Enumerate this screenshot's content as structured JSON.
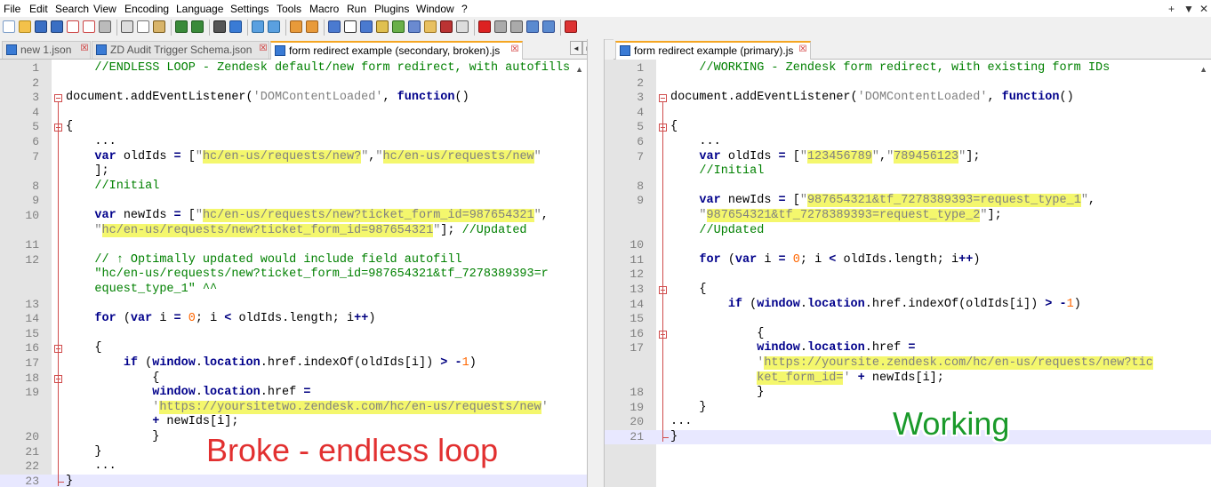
{
  "menubar": {
    "items": [
      "File",
      "Edit",
      "Search",
      "View",
      "Encoding",
      "Language",
      "Settings",
      "Tools",
      "Macro",
      "Run",
      "Plugins",
      "Window",
      "?"
    ],
    "right_controls": [
      "+",
      "▼",
      "✕"
    ]
  },
  "left_tabs": [
    {
      "label": "new 1.json"
    },
    {
      "label": "ZD Audit Trigger Schema.json"
    },
    {
      "label": "form redirect example (secondary, broken).js"
    }
  ],
  "right_tabs": [
    {
      "label": "form redirect example (primary).js"
    }
  ],
  "tab_nav": [
    "◄",
    "►"
  ],
  "annotations": {
    "left": "Broke - endless loop",
    "right": "Working",
    "left_color": "#e23030",
    "right_color": "#1a9a2a"
  },
  "colors": {
    "keyword": "#00008b",
    "comment": "#008000",
    "string": "#808080",
    "number": "#ff6600",
    "highlight": "#f4f76d",
    "current_line": "#e8e8ff",
    "active_tab_accent": "#f5a623"
  },
  "left_editor": {
    "current_line": 23,
    "lines": [
      {
        "n": "1",
        "t": "    //ENDLESS LOOP - Zendesk default/new form redirect, with autofills"
      },
      {
        "n": "2",
        "t": ""
      },
      {
        "n": "3",
        "t": "document.addEventListener('DOMContentLoaded', function()"
      },
      {
        "n": "4",
        "t": ""
      },
      {
        "n": "5",
        "t": "{"
      },
      {
        "n": "6",
        "t": "    ..."
      },
      {
        "n": "7",
        "t": "    var oldIds = [\"hc/en-us/requests/new?\",\"hc/en-us/requests/new\""
      },
      {
        "n": "",
        "t": "    ];"
      },
      {
        "n": "8",
        "t": "    //Initial"
      },
      {
        "n": "9",
        "t": ""
      },
      {
        "n": "10",
        "t": "    var newIds = [\"hc/en-us/requests/new?ticket_form_id=987654321\","
      },
      {
        "n": "",
        "t": "    \"hc/en-us/requests/new?ticket_form_id=987654321\"]; //Updated"
      },
      {
        "n": "11",
        "t": ""
      },
      {
        "n": "12",
        "t": "    // ↑ Optimally updated would include field autofill"
      },
      {
        "n": "",
        "t": "    \"hc/en-us/requests/new?ticket_form_id=987654321&tf_7278389393=r"
      },
      {
        "n": "",
        "t": "    equest_type_1\" ^^"
      },
      {
        "n": "13",
        "t": ""
      },
      {
        "n": "14",
        "t": "    for (var i = 0; i < oldIds.length; i++)"
      },
      {
        "n": "15",
        "t": ""
      },
      {
        "n": "16",
        "t": "    {"
      },
      {
        "n": "17",
        "t": "        if (window.location.href.indexOf(oldIds[i]) > -1)"
      },
      {
        "n": "18",
        "t": "            {"
      },
      {
        "n": "19",
        "t": "            window.location.href ="
      },
      {
        "n": "",
        "t": "            'https://yoursitetwo.zendesk.com/hc/en-us/requests/new'"
      },
      {
        "n": "",
        "t": "            + newIds[i];"
      },
      {
        "n": "20",
        "t": "            }"
      },
      {
        "n": "21",
        "t": "    }"
      },
      {
        "n": "22",
        "t": "    ..."
      },
      {
        "n": "23",
        "t": "}"
      }
    ]
  },
  "right_editor": {
    "current_line": 21,
    "lines": [
      {
        "n": "1",
        "t": "    //WORKING - Zendesk form redirect, with existing form IDs"
      },
      {
        "n": "2",
        "t": ""
      },
      {
        "n": "3",
        "t": "document.addEventListener('DOMContentLoaded', function()"
      },
      {
        "n": "4",
        "t": ""
      },
      {
        "n": "5",
        "t": "{"
      },
      {
        "n": "6",
        "t": "    ..."
      },
      {
        "n": "7",
        "t": "    var oldIds = [\"123456789\",\"789456123\"];"
      },
      {
        "n": "",
        "t": "    //Initial"
      },
      {
        "n": "8",
        "t": ""
      },
      {
        "n": "9",
        "t": "    var newIds = [\"987654321&tf_7278389393=request_type_1\","
      },
      {
        "n": "",
        "t": "    \"987654321&tf_7278389393=request_type_2\"];"
      },
      {
        "n": "",
        "t": "    //Updated"
      },
      {
        "n": "10",
        "t": ""
      },
      {
        "n": "11",
        "t": "    for (var i = 0; i < oldIds.length; i++)"
      },
      {
        "n": "12",
        "t": ""
      },
      {
        "n": "13",
        "t": "    {"
      },
      {
        "n": "14",
        "t": "        if (window.location.href.indexOf(oldIds[i]) > -1)"
      },
      {
        "n": "15",
        "t": ""
      },
      {
        "n": "16",
        "t": "            {"
      },
      {
        "n": "17",
        "t": "            window.location.href ="
      },
      {
        "n": "",
        "t": "            'https://yoursite.zendesk.com/hc/en-us/requests/new?tic"
      },
      {
        "n": "",
        "t": "            ket_form_id=' + newIds[i];"
      },
      {
        "n": "18",
        "t": "            }"
      },
      {
        "n": "19",
        "t": "    }"
      },
      {
        "n": "20",
        "t": "..."
      },
      {
        "n": "21",
        "t": "}"
      }
    ]
  }
}
